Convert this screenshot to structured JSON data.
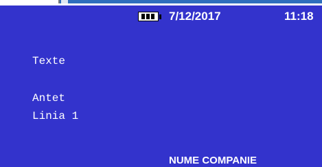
{
  "status": {
    "battery_icon": "battery-icon",
    "battery_level": 1.0,
    "date": "7/12/2017",
    "time": "11:18"
  },
  "content": {
    "title": "Texte",
    "header_label": "Antet",
    "line1_label": "Linia 1"
  },
  "footer": {
    "company_name": "NUME COMPANIE"
  },
  "colors": {
    "screen_background": "#3333cc",
    "text": "#ffffff",
    "top_tab": "#2e6fbd"
  }
}
